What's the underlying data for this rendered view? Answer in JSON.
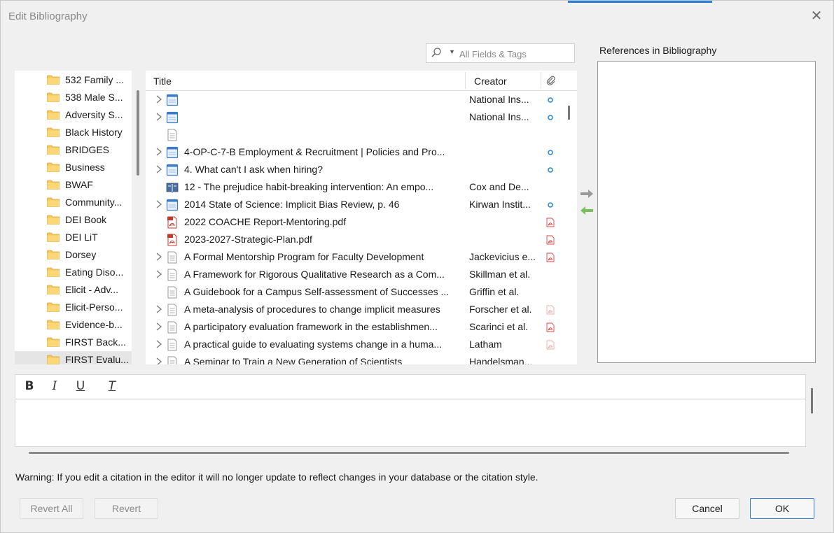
{
  "dialog": {
    "title": "Edit Bibliography",
    "close_symbol": "✕"
  },
  "search": {
    "placeholder": "All Fields & Tags",
    "icon": "search-icon",
    "dropdown_icon": "▼"
  },
  "references": {
    "label": "References in Bibliography"
  },
  "folders": [
    {
      "label": "532 Family ...",
      "selected": false
    },
    {
      "label": "538 Male S...",
      "selected": false
    },
    {
      "label": "Adversity S...",
      "selected": false
    },
    {
      "label": "Black History",
      "selected": false
    },
    {
      "label": "BRIDGES",
      "selected": false
    },
    {
      "label": "Business",
      "selected": false
    },
    {
      "label": "BWAF",
      "selected": false
    },
    {
      "label": "Community...",
      "selected": false
    },
    {
      "label": "DEI Book",
      "selected": false
    },
    {
      "label": "DEI LiT",
      "selected": false
    },
    {
      "label": "Dorsey",
      "selected": false
    },
    {
      "label": "Eating Diso...",
      "selected": false
    },
    {
      "label": "Elicit - Adv...",
      "selected": false
    },
    {
      "label": "Elicit-Perso...",
      "selected": false
    },
    {
      "label": "Evidence-b...",
      "selected": false
    },
    {
      "label": "FIRST Back...",
      "selected": false
    },
    {
      "label": "FIRST Evalu...",
      "selected": true
    }
  ],
  "items": {
    "columns": {
      "title": "Title",
      "creator": "Creator"
    },
    "rows": [
      {
        "title": "",
        "creator": "National Ins...",
        "type": "webpage",
        "expandable": true,
        "attachment": "dot"
      },
      {
        "title": "",
        "creator": "National Ins...",
        "type": "webpage",
        "expandable": true,
        "attachment": "dot"
      },
      {
        "title": "",
        "creator": "",
        "type": "document",
        "expandable": false,
        "attachment": "none"
      },
      {
        "title": "4-OP-C-7-B Employment & Recruitment | Policies and Pro...",
        "creator": "",
        "type": "webpage",
        "expandable": true,
        "attachment": "dot"
      },
      {
        "title": "4. What can't I ask when hiring?",
        "creator": "",
        "type": "webpage",
        "expandable": true,
        "attachment": "dot"
      },
      {
        "title": "12 - The prejudice habit-breaking intervention: An empo...",
        "creator": "Cox and De...",
        "type": "book",
        "expandable": false,
        "attachment": "none"
      },
      {
        "title": "2014 State of Science: Implicit Bias Review, p. 46",
        "creator": "Kirwan Instit...",
        "type": "webpage",
        "expandable": true,
        "attachment": "dot"
      },
      {
        "title": "2022 COACHE Report-Mentoring.pdf",
        "creator": "",
        "type": "pdf",
        "expandable": false,
        "attachment": "pdf"
      },
      {
        "title": "2023-2027-Strategic-Plan.pdf",
        "creator": "",
        "type": "pdf",
        "expandable": false,
        "attachment": "pdf"
      },
      {
        "title": "A Formal Mentorship Program for Faculty Development",
        "creator": "Jackevicius e...",
        "type": "document",
        "expandable": true,
        "attachment": "pdf"
      },
      {
        "title": "A Framework for Rigorous Qualitative Research as a Com...",
        "creator": "Skillman et al.",
        "type": "document",
        "expandable": true,
        "attachment": "none"
      },
      {
        "title": "A Guidebook for a Campus Self-assessment of Successes ...",
        "creator": "Griffin et al.",
        "type": "document",
        "expandable": false,
        "attachment": "none"
      },
      {
        "title": "A meta-analysis of procedures to change implicit measures",
        "creator": "Forscher et al.",
        "type": "document",
        "expandable": true,
        "attachment": "pdf-faded"
      },
      {
        "title": "A participatory evaluation framework in the establishmen...",
        "creator": "Scarinci et al.",
        "type": "document",
        "expandable": true,
        "attachment": "pdf"
      },
      {
        "title": "A practical guide to evaluating systems change in a huma...",
        "creator": "Latham",
        "type": "document",
        "expandable": true,
        "attachment": "pdf-faded"
      },
      {
        "title": "A Seminar to Train a New Generation of Scientists",
        "creator": "Handelsman...",
        "type": "document",
        "expandable": true,
        "attachment": "none"
      }
    ]
  },
  "editor": {
    "bold": "B",
    "italic": "I",
    "underline": "U",
    "clear": "T",
    "content": ""
  },
  "warning": "Warning: If you edit a citation in the editor it will no longer update to reflect changes in your database or the citation style.",
  "buttons": {
    "revert_all": "Revert All",
    "revert": "Revert",
    "cancel": "Cancel",
    "ok": "OK"
  }
}
